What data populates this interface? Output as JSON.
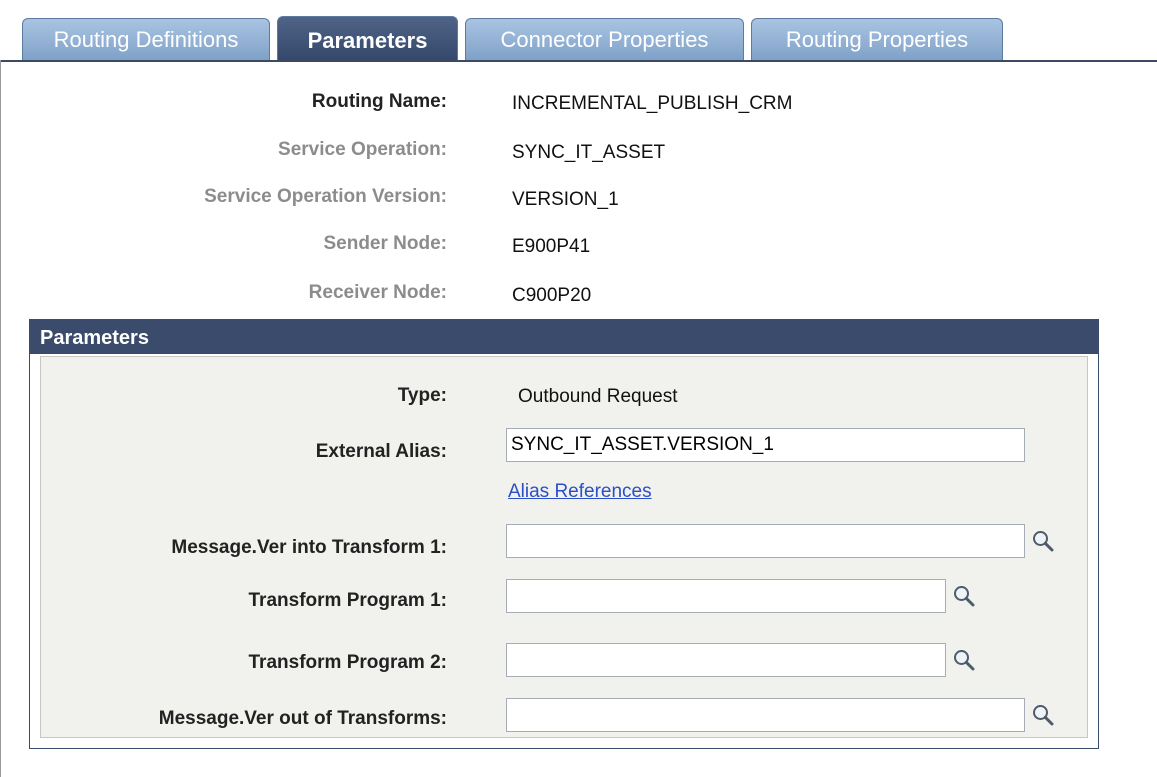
{
  "tabs": [
    {
      "label": "Routing Definitions",
      "active": false
    },
    {
      "label": "Parameters",
      "active": true
    },
    {
      "label": "Connector Properties",
      "active": false
    },
    {
      "label": "Routing Properties",
      "active": false
    }
  ],
  "header": {
    "routing_name_label": "Routing Name:",
    "routing_name": "INCREMENTAL_PUBLISH_CRM",
    "service_operation_label": "Service Operation:",
    "service_operation": "SYNC_IT_ASSET",
    "service_operation_version_label": "Service Operation Version:",
    "service_operation_version": "VERSION_1",
    "sender_node_label": "Sender Node:",
    "sender_node": "E900P41",
    "receiver_node_label": "Receiver Node:",
    "receiver_node": "C900P20"
  },
  "parameters": {
    "title": "Parameters",
    "type_label": "Type:",
    "type_value": "Outbound Request",
    "external_alias_label": "External Alias:",
    "external_alias_value": "SYNC_IT_ASSET.VERSION_1",
    "alias_references_link": "Alias References",
    "msg_into_transform_label": "Message.Ver into Transform 1:",
    "msg_into_transform_value": "",
    "transform_program_1_label": "Transform Program 1:",
    "transform_program_1_value": "",
    "transform_program_2_label": "Transform Program 2:",
    "transform_program_2_value": "",
    "msg_out_of_transforms_label": "Message.Ver out of Transforms:",
    "msg_out_of_transforms_value": ""
  },
  "icons": {
    "lookup": "magnifier-icon"
  },
  "colors": {
    "tab_inactive": "#8fb0d6",
    "tab_active": "#3f5378",
    "group_header": "#3a4b6c",
    "group_body": "#f1f2ee",
    "link": "#2a4fc7"
  }
}
